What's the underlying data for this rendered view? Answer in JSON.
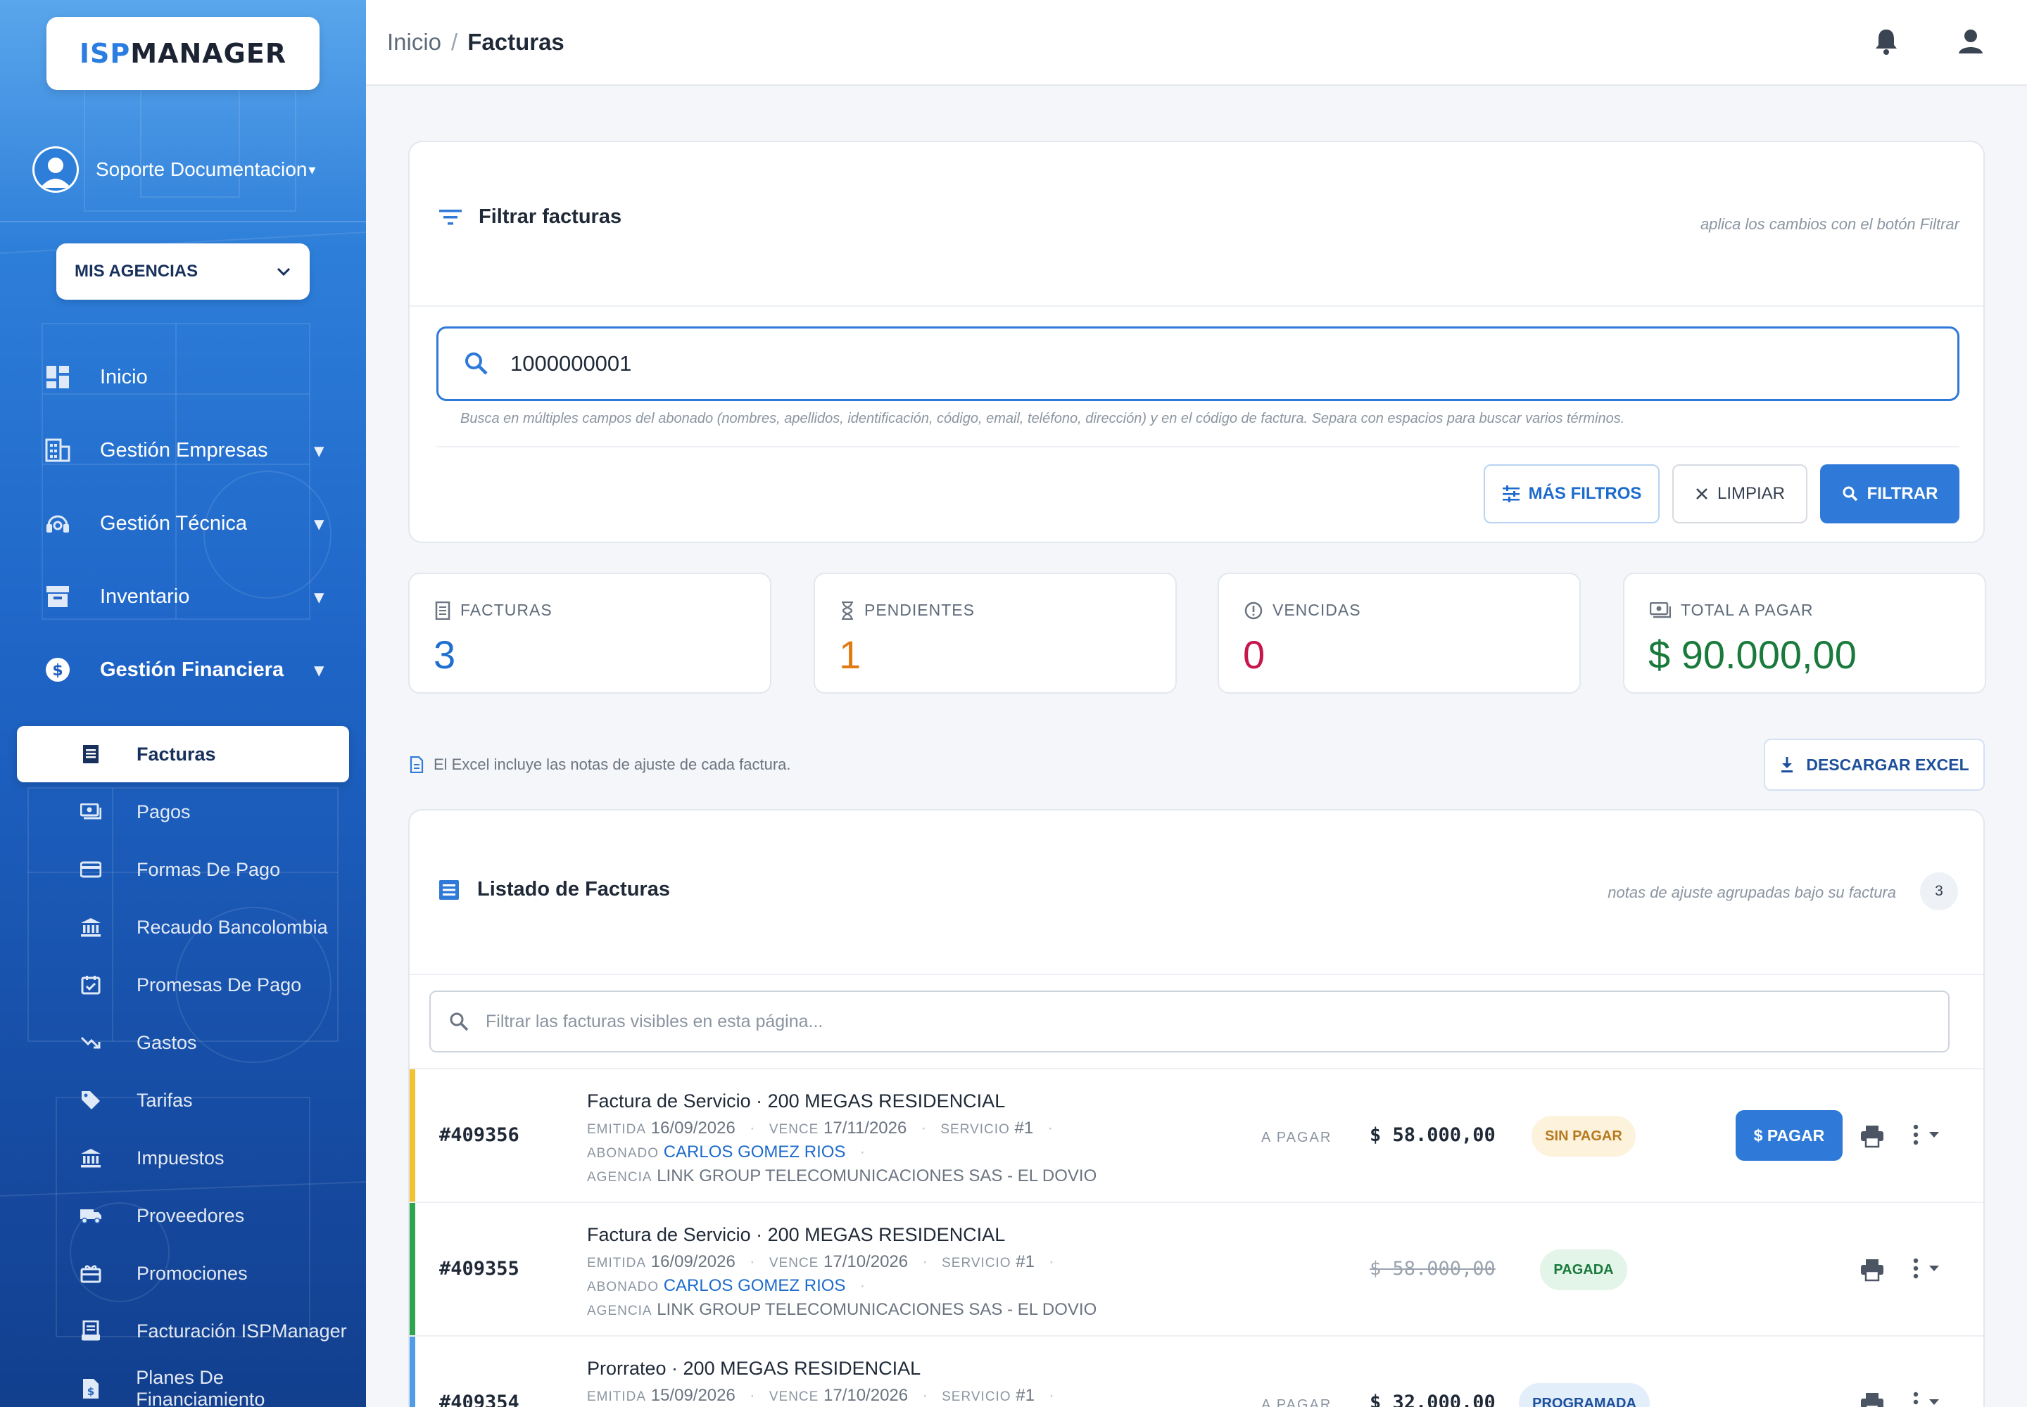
{
  "brand": {
    "logo_part1": "ISP",
    "logo_part2": "MANAGER"
  },
  "user": {
    "name": "Soporte Documentacion"
  },
  "agency_selector": {
    "label": "MIS AGENCIAS"
  },
  "nav": [
    {
      "label": "Inicio"
    },
    {
      "label": "Gestión Empresas"
    },
    {
      "label": "Gestión Técnica"
    },
    {
      "label": "Inventario"
    },
    {
      "label": "Gestión Financiera"
    }
  ],
  "subnav": {
    "active": "Facturas",
    "items": [
      {
        "label": "Pagos"
      },
      {
        "label": "Formas De Pago"
      },
      {
        "label": "Recaudo Bancolombia"
      },
      {
        "label": "Promesas De Pago"
      },
      {
        "label": "Gastos"
      },
      {
        "label": "Tarifas"
      },
      {
        "label": "Impuestos"
      },
      {
        "label": "Proveedores"
      },
      {
        "label": "Promociones"
      },
      {
        "label": "Facturación ISPManager"
      },
      {
        "label": "Planes De Financiamiento"
      }
    ]
  },
  "breadcrumb": {
    "home": "Inicio",
    "separator": "/",
    "current": "Facturas"
  },
  "filter": {
    "title": "Filtrar facturas",
    "hint": "aplica los cambios con el botón Filtrar",
    "search_value": "1000000001",
    "help": "Busca en múltiples campos del abonado (nombres, apellidos, identificación, código, email, teléfono, dirección) y en el código de factura. Separa con espacios para buscar varios términos.",
    "btn_more": "MÁS FILTROS",
    "btn_clear": "LIMPIAR",
    "btn_filter": "FILTRAR"
  },
  "stats": {
    "facturas": {
      "label": "FACTURAS",
      "value": "3",
      "color": "#1f6fd0"
    },
    "pendientes": {
      "label": "PENDIENTES",
      "value": "1",
      "color": "#e07b12"
    },
    "vencidas": {
      "label": "VENCIDAS",
      "value": "0",
      "color": "#c8154b"
    },
    "total": {
      "label": "TOTAL A PAGAR",
      "value": "$ 90.000,00",
      "color": "#1a7a3c"
    }
  },
  "excel": {
    "note": "El Excel incluye las notas de ajuste de cada factura.",
    "button": "DESCARGAR EXCEL"
  },
  "list": {
    "title": "Listado de Facturas",
    "hint": "notas de ajuste agrupadas bajo su factura",
    "count": "3",
    "search_placeholder": "Filtrar las facturas visibles en esta página...",
    "labels": {
      "emitida": "EMITIDA",
      "vence": "VENCE",
      "servicio": "SERVICIO",
      "abonado": "ABONADO",
      "agencia": "AGENCIA",
      "a_pagar": "A PAGAR",
      "pagar_btn": "$ PAGAR"
    },
    "rows": [
      {
        "number": "#409356",
        "title": "Factura de Servicio · 200 MEGAS RESIDENCIAL",
        "emitida": "16/09/2026",
        "vence": "17/11/2026",
        "servicio": "#1",
        "abonado": "CARLOS GOMEZ RIOS",
        "agencia": "LINK GROUP TELECOMUNICACIONES SAS - EL DOVIO",
        "amount_label": "A PAGAR",
        "amount": "$ 58.000,00",
        "status": "SIN PAGAR",
        "status_color": "#b7791f",
        "status_bg": "#fdf3dc",
        "accent": "#f2c230"
      },
      {
        "number": "#409355",
        "title": "Factura de Servicio · 200 MEGAS RESIDENCIAL",
        "emitida": "16/09/2026",
        "vence": "17/10/2026",
        "servicio": "#1",
        "abonado": "CARLOS GOMEZ RIOS",
        "agencia": "LINK GROUP TELECOMUNICACIONES SAS - EL DOVIO",
        "amount": "$ 58.000,00",
        "status": "PAGADA",
        "status_color": "#1a7a3c",
        "status_bg": "#e3f4e8",
        "accent": "#2fa44f"
      },
      {
        "number": "#409354",
        "title": "Prorrateo · 200 MEGAS RESIDENCIAL",
        "emitida": "15/09/2026",
        "vence": "17/10/2026",
        "servicio": "#1",
        "amount_label": "A PAGAR",
        "amount": "$ 32.000,00",
        "status": "PROGRAMADA",
        "status_color": "#1d4f9c",
        "status_bg": "#e3eefb",
        "accent": "#4f9de8"
      }
    ]
  }
}
